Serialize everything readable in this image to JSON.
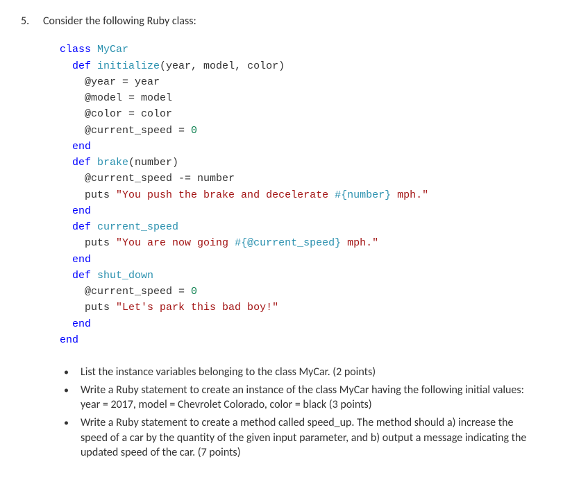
{
  "question": {
    "number": "5.",
    "prompt": "Consider the following Ruby class:"
  },
  "code": {
    "lines": [
      {
        "indent": 0,
        "tokens": [
          {
            "t": "class ",
            "c": "keyword"
          },
          {
            "t": "MyCar",
            "c": "classname"
          }
        ]
      },
      {
        "indent": 1,
        "tokens": [
          {
            "t": "def ",
            "c": "keyword"
          },
          {
            "t": "initialize",
            "c": "method"
          },
          {
            "t": "(year, model, color)",
            "c": "plain"
          }
        ]
      },
      {
        "indent": 2,
        "tokens": [
          {
            "t": "@year = year",
            "c": "plain"
          }
        ]
      },
      {
        "indent": 2,
        "tokens": [
          {
            "t": "@model = model",
            "c": "plain"
          }
        ]
      },
      {
        "indent": 2,
        "tokens": [
          {
            "t": "@color = color",
            "c": "plain"
          }
        ]
      },
      {
        "indent": 2,
        "tokens": [
          {
            "t": "@current_speed = ",
            "c": "plain"
          },
          {
            "t": "0",
            "c": "number"
          }
        ]
      },
      {
        "indent": 1,
        "tokens": [
          {
            "t": "end",
            "c": "keyword"
          }
        ]
      },
      {
        "indent": 1,
        "tokens": [
          {
            "t": "def ",
            "c": "keyword"
          },
          {
            "t": "brake",
            "c": "method"
          },
          {
            "t": "(number)",
            "c": "plain"
          }
        ]
      },
      {
        "indent": 2,
        "tokens": [
          {
            "t": "@current_speed -= number",
            "c": "plain"
          }
        ]
      },
      {
        "indent": 2,
        "tokens": [
          {
            "t": "puts ",
            "c": "plain"
          },
          {
            "t": "\"You push the brake and decelerate ",
            "c": "string"
          },
          {
            "t": "#{number}",
            "c": "interp"
          },
          {
            "t": " mph.\"",
            "c": "string"
          }
        ]
      },
      {
        "indent": 1,
        "tokens": [
          {
            "t": "end",
            "c": "keyword"
          }
        ]
      },
      {
        "indent": 1,
        "tokens": [
          {
            "t": "def ",
            "c": "keyword"
          },
          {
            "t": "current_speed",
            "c": "method"
          }
        ]
      },
      {
        "indent": 2,
        "tokens": [
          {
            "t": "puts ",
            "c": "plain"
          },
          {
            "t": "\"You are now going ",
            "c": "string"
          },
          {
            "t": "#{@current_speed}",
            "c": "interp"
          },
          {
            "t": " mph.\"",
            "c": "string"
          }
        ]
      },
      {
        "indent": 1,
        "tokens": [
          {
            "t": "end",
            "c": "keyword"
          }
        ]
      },
      {
        "indent": 1,
        "tokens": [
          {
            "t": "def ",
            "c": "keyword"
          },
          {
            "t": "shut_down",
            "c": "method"
          }
        ]
      },
      {
        "indent": 2,
        "tokens": [
          {
            "t": "@current_speed = ",
            "c": "plain"
          },
          {
            "t": "0",
            "c": "number"
          }
        ]
      },
      {
        "indent": 2,
        "tokens": [
          {
            "t": "puts ",
            "c": "plain"
          },
          {
            "t": "\"Let's park this bad boy!\"",
            "c": "string"
          }
        ]
      },
      {
        "indent": 1,
        "tokens": [
          {
            "t": "end",
            "c": "keyword"
          }
        ]
      },
      {
        "indent": 0,
        "tokens": [
          {
            "t": "end",
            "c": "keyword"
          }
        ]
      }
    ]
  },
  "bullets": [
    "List the instance variables belonging to the class MyCar. (2 points)",
    "Write a Ruby statement to create an instance of the class MyCar having the following initial values: year = 2017, model = Chevrolet Colorado, color = black (3 points)",
    "Write a Ruby statement to create a method called speed_up. The method should a) increase the speed of a car by the quantity of the given input parameter, and b) output a message indicating the updated speed of the car.  (7 points)"
  ]
}
